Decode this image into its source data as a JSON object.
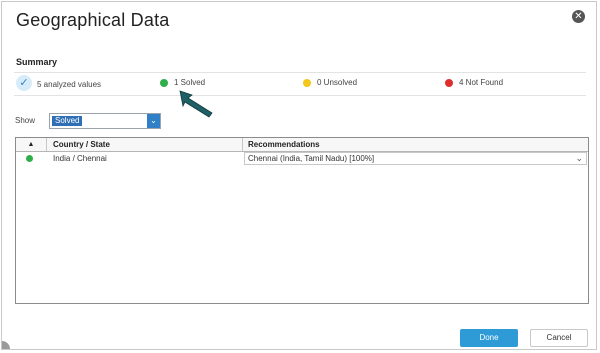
{
  "dialog": {
    "title": "Geographical Data",
    "close_icon": "close-icon"
  },
  "summary": {
    "heading": "Summary",
    "analyzed": "5 analyzed values",
    "solved": "1 Solved",
    "unsolved": "0 Unsolved",
    "not_found": "4 Not Found",
    "colors": {
      "solved": "#2fae4a",
      "unsolved": "#f2c81b",
      "not_found": "#e02d2d"
    }
  },
  "filter": {
    "label": "Show",
    "selected": "Solved"
  },
  "grid": {
    "columns": [
      "Country / State",
      "Recommendations"
    ],
    "rows": [
      {
        "status": "solved",
        "country": "India / Chennai",
        "recommendation": "Chennai (India, Tamil Nadu) [100%]"
      }
    ]
  },
  "footer": {
    "done": "Done",
    "cancel": "Cancel"
  },
  "accent": "#2e9ad6"
}
